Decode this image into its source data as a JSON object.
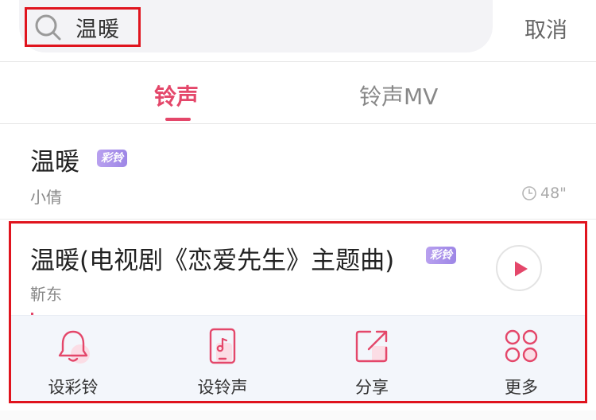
{
  "search": {
    "query": "温暖",
    "cancel_label": "取消"
  },
  "tabs": [
    {
      "label": "铃声",
      "active": true
    },
    {
      "label": "铃声MV",
      "active": false
    }
  ],
  "results": [
    {
      "title": "温暖",
      "badge": "彩铃",
      "artist": "小倩",
      "duration": "48\""
    },
    {
      "title": "温暖(电视剧《恋爱先生》主题曲)",
      "badge": "彩铃",
      "artist": "靳东"
    }
  ],
  "actions": [
    {
      "label": "设彩铃",
      "icon": "bell-icon"
    },
    {
      "label": "设铃声",
      "icon": "phone-music-icon"
    },
    {
      "label": "分享",
      "icon": "share-icon"
    },
    {
      "label": "更多",
      "icon": "more-circles-icon"
    }
  ],
  "colors": {
    "accent": "#e4476a",
    "badge": "#a58de8",
    "highlight": "#e0141e"
  }
}
